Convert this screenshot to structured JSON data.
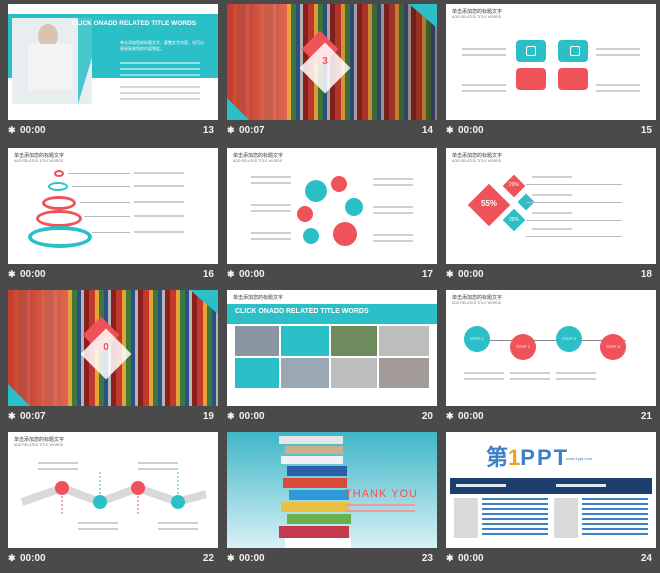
{
  "slides": [
    {
      "num": "13",
      "time": "00:00",
      "header": "CLICK ONADD RELATED TITLE WORDS",
      "body": "单击添加您的标题文字，要整文字内容，也可以直接复制您的内容到此。"
    },
    {
      "num": "14",
      "time": "00:07",
      "badge_num": "3"
    },
    {
      "num": "15",
      "time": "00:00",
      "title": "单击添加您的标题文字",
      "subtitle": "ADD RELATED TITLE WORDS"
    },
    {
      "num": "16",
      "time": "00:00",
      "title": "单击添加您的标题文字",
      "subtitle": "ADD RELATED TITLE WORDS"
    },
    {
      "num": "17",
      "time": "00:00",
      "title": "单击添加您的标题文字",
      "subtitle": "ADD RELATED TITLE WORDS"
    },
    {
      "num": "18",
      "time": "00:00",
      "title": "单击添加您的标题文字",
      "subtitle": "ADD RELATED TITLE WORDS",
      "pct_big": "55%",
      "pct_a": "20%",
      "pct_b": "25%"
    },
    {
      "num": "19",
      "time": "00:07",
      "badge_num": "0"
    },
    {
      "num": "20",
      "time": "00:00",
      "title": "单击添加您的标题文字",
      "header": "CLICK ONADD RELATED TITLE WORDS"
    },
    {
      "num": "21",
      "time": "00:00",
      "title": "单击添加您的标题文字",
      "subtitle": "ADD RELATED TITLE WORDS",
      "steps": [
        "STEP 1",
        "STEP 2",
        "STEP 3",
        "STEP 4"
      ]
    },
    {
      "num": "22",
      "time": "00:00",
      "title": "单击添加您的标题文字",
      "subtitle": "ADD RELATED TITLE WORDS"
    },
    {
      "num": "23",
      "time": "00:00",
      "thank": "THANK YOU"
    },
    {
      "num": "24",
      "time": "00:00",
      "logo_a": "第",
      "logo_b": "1",
      "logo_c": "PPT",
      "url": "www.1ppt.com"
    }
  ],
  "colors": {
    "teal": "#2bbfc7",
    "coral": "#f0525a",
    "background": "#4a4a4a"
  }
}
